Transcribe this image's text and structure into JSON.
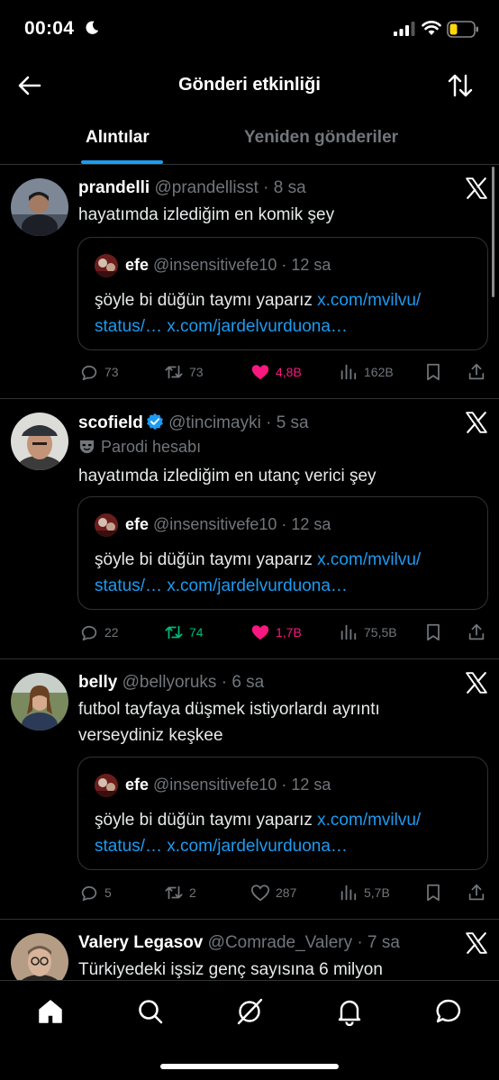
{
  "status_bar": {
    "time": "00:04"
  },
  "header": {
    "title": "Gönderi etkinliği"
  },
  "tabs": [
    {
      "label": "Alıntılar",
      "active": true
    },
    {
      "label": "Yeniden gönderiler",
      "active": false
    }
  ],
  "quoted_post": {
    "name": "efe",
    "handle": "@insensitivefe10",
    "time": "12 sa",
    "text": "şöyle bi düğün taymı yaparız ",
    "link1": "x.com/mvilvu/",
    "link1b": "status/…",
    "link2": "x.com/jardelvurduona…"
  },
  "posts": [
    {
      "name": "prandelli",
      "handle": "@prandellisst",
      "time": "8 sa",
      "text": "hayatımda izlediğim en komik şey",
      "replies": "73",
      "reposts": "73",
      "likes": "4,8B",
      "views": "162B"
    },
    {
      "name": "scofield",
      "handle": "@tincimayki",
      "time": "5 sa",
      "badge": "Parodi hesabı",
      "text": "hayatımda izlediğim en utanç verici şey",
      "replies": "22",
      "reposts": "74",
      "likes": "1,7B",
      "views": "75,5B"
    },
    {
      "name": "belly",
      "handle": "@bellyoruks",
      "time": "6 sa",
      "text": "futbol tayfaya düşmek istiyorlardı ayrıntı verseydiniz keşkee",
      "replies": "5",
      "reposts": "2",
      "likes": "287",
      "views": "5,7B"
    },
    {
      "name": "Valery Legasov",
      "handle": "@Comrade_Valery",
      "time": "7 sa",
      "text": "Türkiyedeki işsiz genç sayısına 6  milyon"
    }
  ],
  "colors": {
    "accent": "#1d9bf0",
    "like": "#f91880",
    "repost": "#00ba7c",
    "muted": "#71767b"
  },
  "icons": [
    "back-arrow-icon",
    "sort-icon",
    "x-logo-icon",
    "reply-icon",
    "repost-icon",
    "heart-icon",
    "views-icon",
    "bookmark-icon",
    "share-icon",
    "home-icon",
    "search-icon",
    "grok-icon",
    "bell-icon",
    "messages-icon"
  ]
}
